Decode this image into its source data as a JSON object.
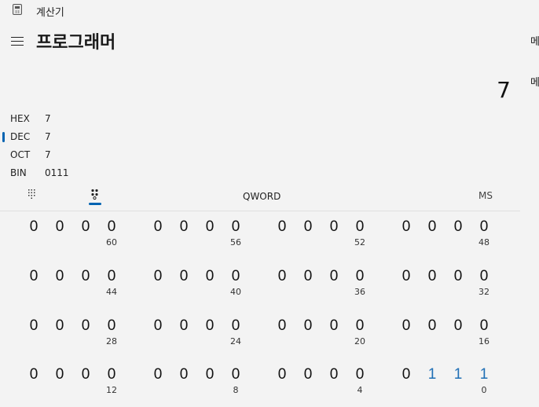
{
  "window": {
    "title": "계산기",
    "icon": "calculator-icon"
  },
  "header": {
    "mode_title": "프로그래머",
    "menu_icon": "hamburger-menu-icon"
  },
  "memory_panel": {
    "labels": [
      "메",
      "메"
    ]
  },
  "display": {
    "value": "7"
  },
  "radix": [
    {
      "name": "HEX",
      "value": "7",
      "selected": false
    },
    {
      "name": "DEC",
      "value": "7",
      "selected": true
    },
    {
      "name": "OCT",
      "value": "7",
      "selected": false
    },
    {
      "name": "BIN",
      "value": "0111",
      "selected": false
    }
  ],
  "toolbar": {
    "keypad_icon": "full-keypad-icon",
    "bitflip_icon": "bit-toggling-keypad-icon",
    "word_size": "QWORD",
    "memory_store": "MS"
  },
  "bit_rows": [
    {
      "bits": [
        "0",
        "0",
        "0",
        "0",
        "0",
        "0",
        "0",
        "0",
        "0",
        "0",
        "0",
        "0",
        "0",
        "0",
        "0",
        "0"
      ],
      "positions": [
        "60",
        "56",
        "52",
        "48"
      ]
    },
    {
      "bits": [
        "0",
        "0",
        "0",
        "0",
        "0",
        "0",
        "0",
        "0",
        "0",
        "0",
        "0",
        "0",
        "0",
        "0",
        "0",
        "0"
      ],
      "positions": [
        "44",
        "40",
        "36",
        "32"
      ]
    },
    {
      "bits": [
        "0",
        "0",
        "0",
        "0",
        "0",
        "0",
        "0",
        "0",
        "0",
        "0",
        "0",
        "0",
        "0",
        "0",
        "0",
        "0"
      ],
      "positions": [
        "28",
        "24",
        "20",
        "16"
      ]
    },
    {
      "bits": [
        "0",
        "0",
        "0",
        "0",
        "0",
        "0",
        "0",
        "0",
        "0",
        "0",
        "0",
        "0",
        "0",
        "1",
        "1",
        "1"
      ],
      "positions": [
        "12",
        "8",
        "4",
        "0"
      ]
    }
  ],
  "colors": {
    "accent": "#0063b1",
    "bit_on": "#1f6fb5",
    "background": "#f3f3f3"
  }
}
